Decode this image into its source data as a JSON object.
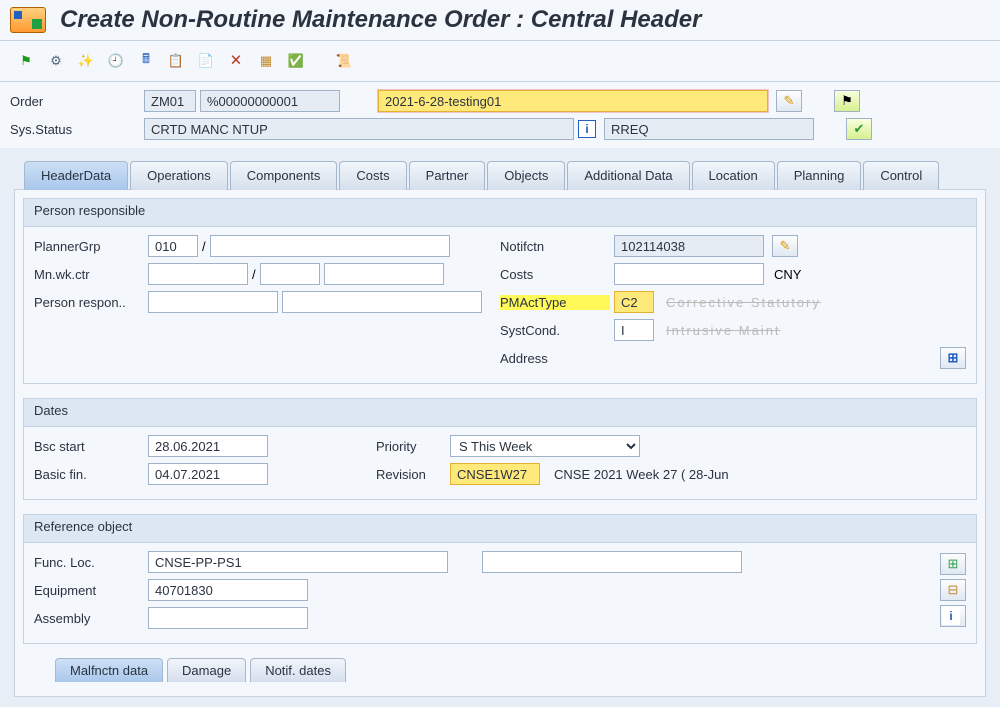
{
  "title": "Create Non-Routine Maintenance Order : Central Header",
  "header": {
    "order_label": "Order",
    "order_type": "ZM01",
    "order_number": "%00000000001",
    "order_desc": "2021-6-28-testing01",
    "sys_status_label": "Sys.Status",
    "sys_status_1": "CRTD MANC NTUP",
    "sys_status_2": "RREQ"
  },
  "tabs": [
    "HeaderData",
    "Operations",
    "Components",
    "Costs",
    "Partner",
    "Objects",
    "Additional Data",
    "Location",
    "Planning",
    "Control"
  ],
  "person_group_title": "Person responsible",
  "person": {
    "planner_grp_label": "PlannerGrp",
    "planner_grp": "010",
    "mn_wk_ctr_label": "Mn.wk.ctr",
    "mn_wk_ctr": " ",
    "person_respon_label": "Person respon..",
    "person_respon": ""
  },
  "notif": {
    "notifctn_label": "Notifctn",
    "notifctn": "102114038",
    "costs_label": "Costs",
    "costs": "",
    "currency": "CNY",
    "pmact_label": "PMActType",
    "pmact": "C2",
    "pmact_desc": "Corrective Statutory",
    "systcond_label": "SystCond.",
    "systcond": "I",
    "systcond_desc": "Intrusive Maint",
    "address_label": "Address"
  },
  "dates_group_title": "Dates",
  "dates": {
    "bsc_start_label": "Bsc start",
    "bsc_start": "28.06.2021",
    "basic_fin_label": "Basic fin.",
    "basic_fin": "04.07.2021",
    "priority_label": "Priority",
    "priority": "S This Week",
    "revision_label": "Revision",
    "revision": "CNSE1W27",
    "revision_desc": "CNSE 2021 Week 27 ( 28-Jun"
  },
  "ref_group_title": "Reference object",
  "ref": {
    "func_loc_label": "Func. Loc.",
    "func_loc": "CNSE-PP-PS1",
    "equipment_label": "Equipment",
    "equipment": "40701830",
    "assembly_label": "Assembly",
    "assembly": ""
  },
  "sub_tabs": [
    "Malfnctn data",
    "Damage",
    "Notif. dates"
  ]
}
